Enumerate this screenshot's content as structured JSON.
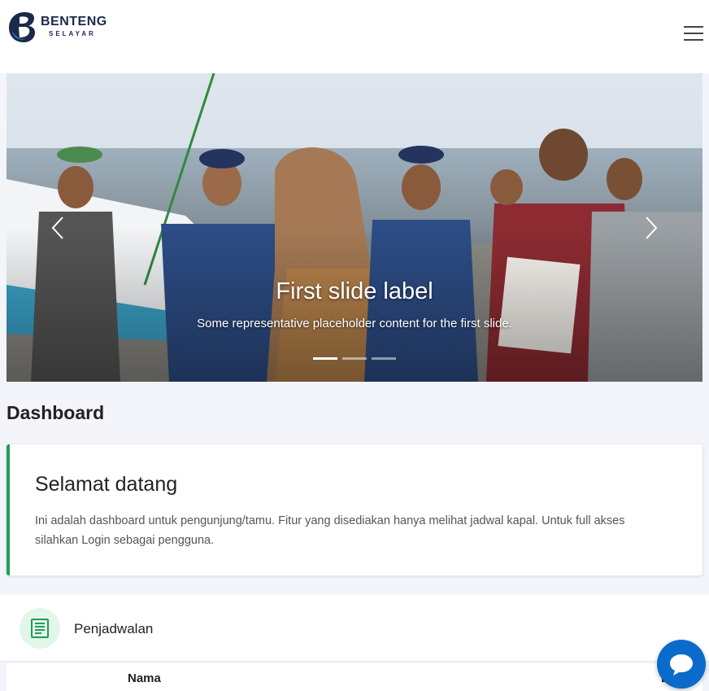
{
  "brand": {
    "name": "BENTENG",
    "tagline": "SELAYAR"
  },
  "navbar": {
    "menu_icon": "hamburger-menu-icon"
  },
  "carousel": {
    "caption_title": "First slide label",
    "caption_text": "Some representative placeholder content for the first slide.",
    "prev_icon": "chevron-left-icon",
    "next_icon": "chevron-right-icon",
    "indicators": 3,
    "active_indicator": 0
  },
  "page": {
    "heading": "Dashboard"
  },
  "welcome": {
    "title": "Selamat datang",
    "text": "Ini adalah dashboard untuk pengunjung/tamu. Fitur yang disediakan hanya melihat jadwal kapal. Untuk full akses silahkan Login sebagai pengguna.",
    "accent_color": "#1f9d55"
  },
  "schedule": {
    "icon": "document-list-icon",
    "label": "Penjadwalan"
  },
  "table": {
    "columns": [
      "Nama",
      "L"
    ]
  },
  "chat": {
    "icon": "chat-bubble-icon",
    "color": "#0b6bcb"
  }
}
